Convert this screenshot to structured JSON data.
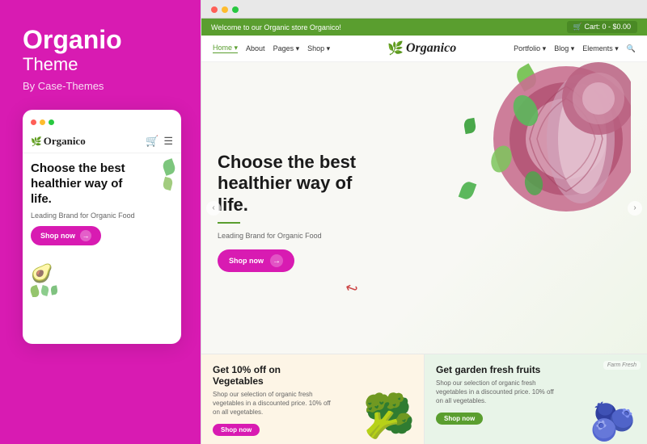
{
  "left": {
    "title": "Organio",
    "subtitle": "Theme",
    "by": "By Case-Themes"
  },
  "mobile": {
    "logo": "Organico",
    "leaf": "🌿",
    "heading": "Choose the best healthier way of life.",
    "sub": "Leading Brand for Organic Food",
    "btn_label": "Shop now",
    "dots": [
      "red",
      "yellow",
      "green"
    ]
  },
  "browser": {
    "dots": [
      "r",
      "y",
      "g"
    ]
  },
  "website": {
    "announce": "Welcome to our Organic store Organico!",
    "cart": "🛒 Cart: 0 - $0.00",
    "nav": {
      "links": [
        "Home ▾",
        "About",
        "Pages ▾",
        "Shop ▾"
      ],
      "logo": "Organico",
      "right_links": [
        "Portfolio ▾",
        "Blog ▾",
        "Elements ▾",
        "🔍"
      ]
    },
    "hero": {
      "heading": "Choose the best healthier way of life.",
      "sub": "Leading Brand for Organic Food",
      "btn_label": "Shop now"
    },
    "cards": [
      {
        "title": "Get 10% off on Vegetables",
        "desc": "Shop our selection of organic fresh vegetables in a discounted price. 10% off on all vegetables.",
        "btn_label": "Shop now",
        "btn_type": "pink",
        "emoji": "🥦"
      },
      {
        "title": "Get garden fresh fruits",
        "desc": "Shop our selection of organic fresh vegetables in a discounted price. 10% off on all vegetables.",
        "btn_label": "Shop now",
        "btn_type": "green",
        "badge": "Farm Fresh",
        "emoji": "🫐"
      }
    ]
  }
}
